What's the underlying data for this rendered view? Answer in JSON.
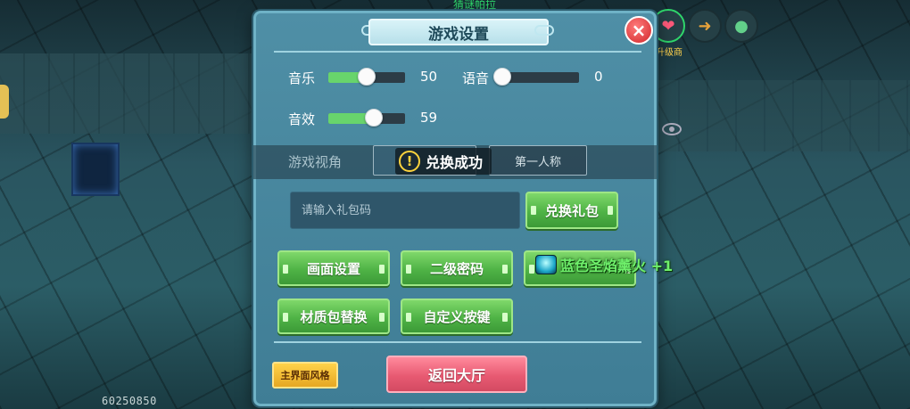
{
  "colors": {
    "panel_bg": "#4f8fa6",
    "green_button": "#4fb346",
    "red_button": "#e85a72",
    "yellow_button": "#e6a723",
    "slider_fill": "#68d46c",
    "reward_text": "#6ff06b"
  },
  "background": {
    "top_text": "猜谜帕拉",
    "hud_label": "升级商",
    "watermark": "60250850"
  },
  "panel": {
    "title": "游戏设置",
    "close_icon": "×"
  },
  "audio": {
    "music": {
      "label": "音乐",
      "value": "50",
      "level": 0.5
    },
    "voice": {
      "label": "语音",
      "value": "0",
      "level": 0.0
    },
    "sfx": {
      "label": "音效",
      "value": "59",
      "level": 0.59
    }
  },
  "view": {
    "label": "游戏视角",
    "option_a": "",
    "option_b": "第一人称"
  },
  "toast": {
    "icon": "!",
    "text": "兑换成功"
  },
  "gift": {
    "placeholder": "请输入礼包码",
    "redeem_label": "兑换礼包"
  },
  "buttons": {
    "graphics": "画面设置",
    "secondary_password": "二级密码",
    "third": "",
    "texture_pack": "材质包替换",
    "custom_keys": "自定义按键",
    "main_style": "主界面风格",
    "back_lobby": "返回大厅"
  },
  "reward": {
    "text": "蓝色圣焰薰火 +1"
  }
}
